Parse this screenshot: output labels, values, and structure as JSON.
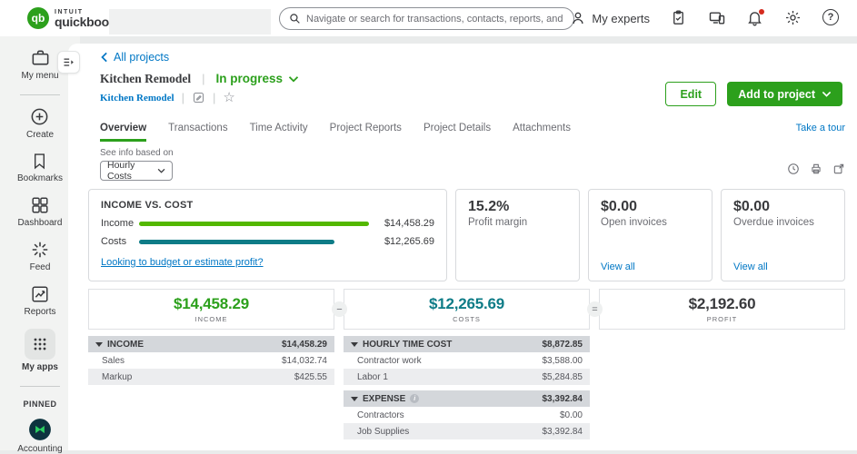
{
  "glyphs": {
    "star": "☆",
    "info": "i",
    "question": "?",
    "minus": "−",
    "equals": "=",
    "qb": "qb"
  },
  "header": {
    "brand_top": "intuit",
    "brand_bottom": "quickbooks",
    "search_placeholder": "Navigate or search for transactions, contacts, reports, and more",
    "my_experts": "My experts"
  },
  "sidebar": {
    "items": [
      {
        "label": "My menu",
        "icon": "briefcase-icon"
      },
      {
        "label": "Create",
        "icon": "plus-circle-icon"
      },
      {
        "label": "Bookmarks",
        "icon": "bookmark-icon"
      },
      {
        "label": "Dashboard",
        "icon": "grid-icon"
      },
      {
        "label": "Feed",
        "icon": "spark-icon"
      },
      {
        "label": "Reports",
        "icon": "chart-icon"
      },
      {
        "label": "My apps",
        "icon": "dots-grid-icon"
      }
    ],
    "pinned_heading": "PINNED",
    "pinned_item": "Accounting"
  },
  "project": {
    "back_link": "All projects",
    "name": "Kitchen Remodel",
    "status": "In progress",
    "subtitle_link": "Kitchen Remodel",
    "separator": "|",
    "edit_button": "Edit",
    "add_to_project_button": "Add to project"
  },
  "tabs": [
    "Overview",
    "Transactions",
    "Time Activity",
    "Project Reports",
    "Project Details",
    "Attachments"
  ],
  "take_a_tour": "Take a tour",
  "filter": {
    "label": "See info based on",
    "value": "Hourly Costs"
  },
  "cards": {
    "income_vs_cost": {
      "title": "INCOME VS. COST",
      "rows": [
        {
          "label": "Income",
          "value": "$14,458.29",
          "pct": 100
        },
        {
          "label": "Costs",
          "value": "$12,265.69",
          "pct": 85
        }
      ],
      "link": "Looking to budget or estimate profit?"
    },
    "profit_margin": {
      "value": "15.2%",
      "label": "Profit margin"
    },
    "open_invoices": {
      "value": "$0.00",
      "label": "Open invoices",
      "link": "View all"
    },
    "overdue_invoices": {
      "value": "$0.00",
      "label": "Overdue invoices",
      "link": "View all"
    }
  },
  "summary": {
    "income": {
      "value": "$14,458.29",
      "label": "INCOME"
    },
    "costs": {
      "value": "$12,265.69",
      "label": "COSTS"
    },
    "profit": {
      "value": "$2,192.60",
      "label": "PROFIT"
    }
  },
  "tables": {
    "income": {
      "header": "INCOME",
      "total": "$14,458.29",
      "rows": [
        {
          "name": "Sales",
          "amount": "$14,032.74"
        },
        {
          "name": "Markup",
          "amount": "$425.55"
        }
      ]
    },
    "hourly": {
      "header": "HOURLY TIME COST",
      "total": "$8,872.85",
      "rows": [
        {
          "name": "Contractor work",
          "amount": "$3,588.00"
        },
        {
          "name": "Labor 1",
          "amount": "$5,284.85"
        }
      ]
    },
    "expense": {
      "header": "EXPENSE",
      "total": "$3,392.84",
      "rows": [
        {
          "name": "Contractors",
          "amount": "$0.00"
        },
        {
          "name": "Job Supplies",
          "amount": "$3,392.84"
        }
      ]
    }
  },
  "colors": {
    "brand_green": "#2ca01c",
    "income_bar_green": "#53b700",
    "costs_teal": "#0e7c87",
    "link_blue": "#0077c5",
    "alert_red": "#d52b1e"
  }
}
